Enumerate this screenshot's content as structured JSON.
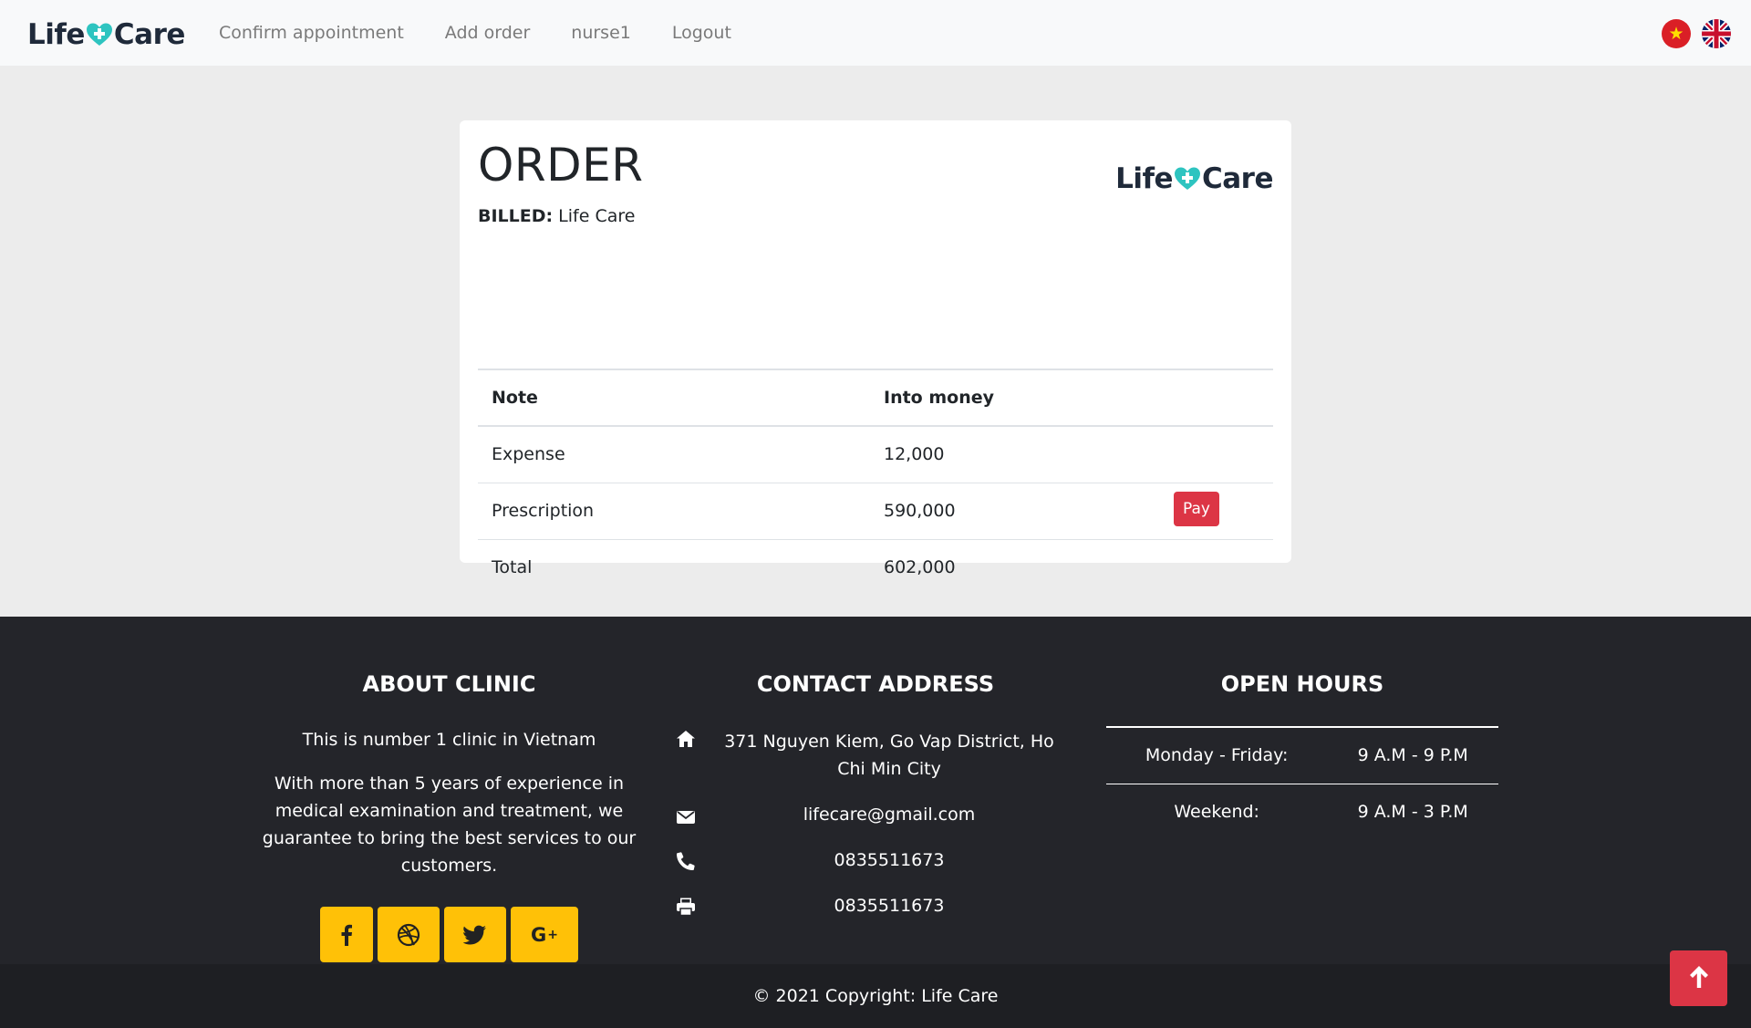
{
  "brand": {
    "name_left": "Life",
    "name_right": "Care",
    "colors": {
      "teal": "#2ec4c0",
      "navy": "#1f2a3a"
    }
  },
  "nav": {
    "items": [
      {
        "label": "Confirm appointment"
      },
      {
        "label": "Add order"
      },
      {
        "label": "nurse1"
      },
      {
        "label": "Logout"
      }
    ],
    "flags": [
      {
        "icon": "vietnam-flag-icon"
      },
      {
        "icon": "uk-flag-icon"
      }
    ]
  },
  "order": {
    "title": "ORDER",
    "billed_label": "BILLED:",
    "billed_value": "Life Care",
    "columns": [
      "Note",
      "Into money"
    ],
    "rows": [
      {
        "note": "Expense",
        "amount": "12,000"
      },
      {
        "note": "Prescription",
        "amount": "590,000"
      },
      {
        "note": "Total",
        "amount": "602,000"
      }
    ],
    "pay_label": "Pay",
    "pay_color": "#dc3545"
  },
  "footer": {
    "about": {
      "title": "ABOUT CLINIC",
      "line1": "This is number 1 clinic in Vietnam",
      "line2": "With more than 5 years of experience in medical examination and treatment, we guarantee to bring the best services to our customers.",
      "socials": [
        {
          "icon": "facebook-icon",
          "glyph": "f"
        },
        {
          "icon": "dribbble-icon",
          "glyph": "⊕"
        },
        {
          "icon": "twitter-icon",
          "glyph": "🐦"
        },
        {
          "icon": "google-plus-icon",
          "glyph": "G+"
        }
      ],
      "social_color": "#ffc107"
    },
    "contact": {
      "title": "CONTACT ADDRESS",
      "address": "371 Nguyen Kiem, Go Vap District, Ho Chi Min City",
      "email": "lifecare@gmail.com",
      "phone": "0835511673",
      "fax": "0835511673"
    },
    "hours": {
      "title": "OPEN HOURS",
      "rows": [
        {
          "day": "Monday - Friday:",
          "time": "9 A.M - 9 P.M"
        },
        {
          "day": "Weekend:",
          "time": "9 A.M - 3 P.M"
        }
      ]
    },
    "copyright": "© 2021 Copyright: Life Care"
  }
}
